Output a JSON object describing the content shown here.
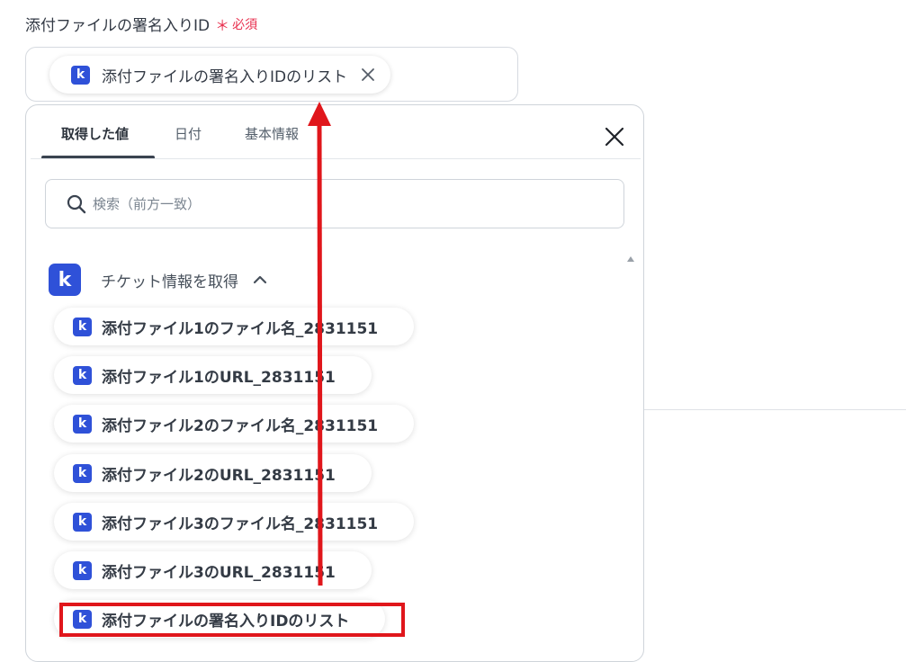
{
  "field": {
    "label": "添付ファイルの署名入りID",
    "required_mark": "＊",
    "required_text": "必須",
    "chip_icon_letter": "k",
    "chip_text": "添付ファイルの署名入りIDのリスト"
  },
  "panel": {
    "tabs": [
      {
        "label": "取得した値",
        "active": true
      },
      {
        "label": "日付",
        "active": false
      },
      {
        "label": "基本情報",
        "active": false
      }
    ],
    "search_placeholder": "検索（前方一致）",
    "section": {
      "icon_letter": "k",
      "title": "チケット情報を取得",
      "expanded": true
    },
    "items": [
      {
        "icon_letter": "k",
        "label": "添付ファイル1のファイル名_2831151"
      },
      {
        "icon_letter": "k",
        "label": "添付ファイル1のURL_2831151"
      },
      {
        "icon_letter": "k",
        "label": "添付ファイル2のファイル名_2831151"
      },
      {
        "icon_letter": "k",
        "label": "添付ファイル2のURL_2831151"
      },
      {
        "icon_letter": "k",
        "label": "添付ファイル3のファイル名_2831151"
      },
      {
        "icon_letter": "k",
        "label": "添付ファイル3のURL_2831151"
      },
      {
        "icon_letter": "k",
        "label": "添付ファイルの署名入りIDのリスト",
        "highlighted": true
      }
    ]
  },
  "colors": {
    "brand_icon": "#2f51d8",
    "required": "#e8304f",
    "annotation_red": "#e0161b"
  }
}
